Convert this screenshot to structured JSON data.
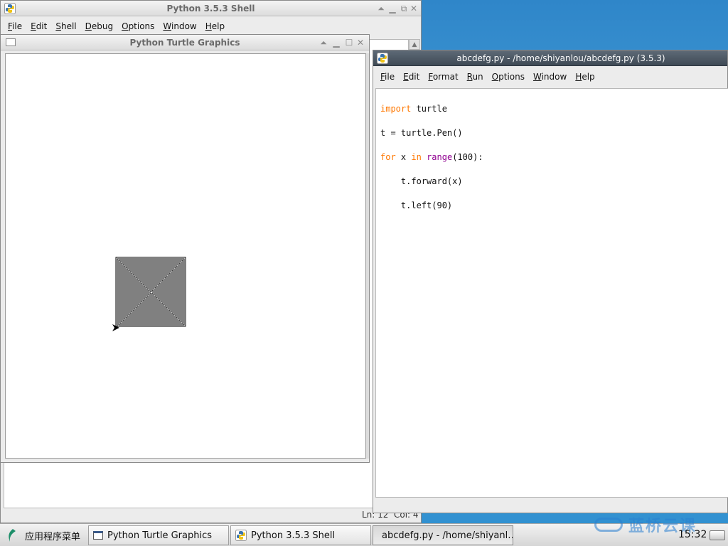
{
  "shell_window": {
    "title": "Python 3.5.3 Shell",
    "menu": [
      "File",
      "Edit",
      "Shell",
      "Debug",
      "Options",
      "Window",
      "Help"
    ],
    "status": {
      "line": "Ln: 12",
      "col": "Col: 4"
    }
  },
  "turtle_window": {
    "title": "Python Turtle Graphics"
  },
  "editor_window": {
    "title": "abcdefg.py - /home/shiyanlou/abcdefg.py (3.5.3)",
    "menu": [
      "File",
      "Edit",
      "Format",
      "Run",
      "Options",
      "Window",
      "Help"
    ],
    "code": {
      "l1_kw": "import",
      "l1_rest": " turtle",
      "l2": "t = turtle.Pen()",
      "l3_kw": "for",
      "l3_a": " x ",
      "l3_kw2": "in",
      "l3_sp": " ",
      "l3_bi": "range",
      "l3_rest": "(100):",
      "l4": "    t.forward(x)",
      "l5": "    t.left(90)"
    }
  },
  "taskbar": {
    "start_label": "应用程序菜单",
    "tasks": [
      "Python Turtle Graphics",
      "Python 3.5.3 Shell",
      "abcdefg.py - /home/shiyanl…"
    ],
    "clock": "15:32"
  },
  "watermark": "蓝桥云课",
  "icons": {
    "python": "python-app-icon",
    "minimize": "minimize-icon",
    "maximize": "maximize-icon",
    "close": "close-icon",
    "shade": "shade-icon",
    "start": "start-menu-icon",
    "keyboard": "keyboard-icon"
  }
}
